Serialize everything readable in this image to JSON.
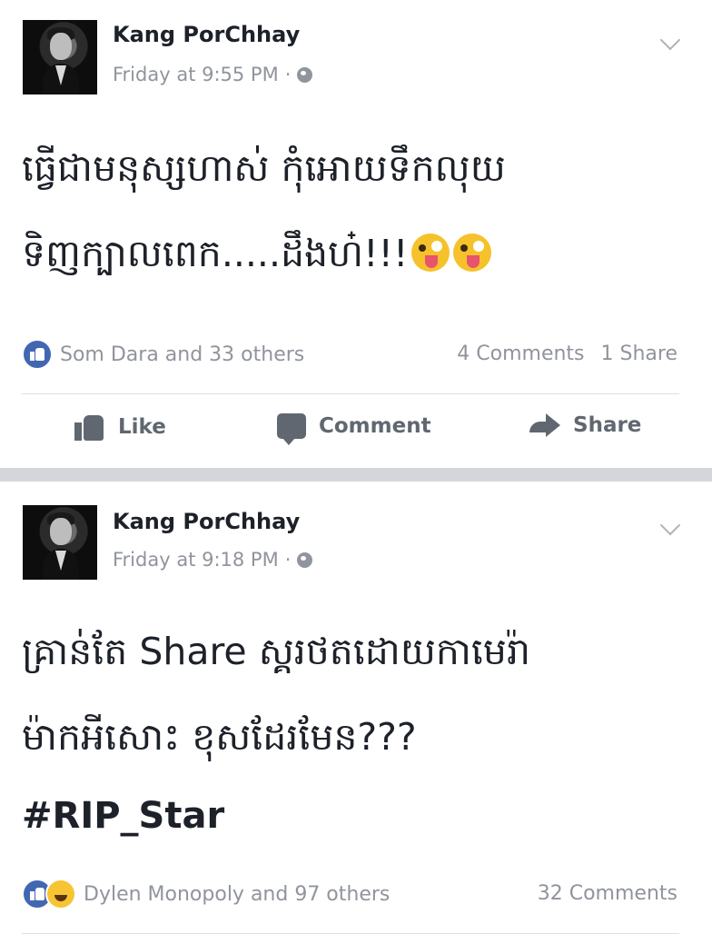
{
  "posts": [
    {
      "author": "Kang PorChhay",
      "timestamp": "Friday at 9:55 PM",
      "separator": "·",
      "privacy_icon": "globe-icon",
      "text_line_1": "ធ្វើជាមនុស្សហាស់ កុំអោយទឹកលុយ",
      "text_line_2": "ទិញក្បាលពេក.....ដឹងហ៎!!!",
      "emojis": [
        "winking-tongue-emoji",
        "winking-tongue-emoji"
      ],
      "reactions_text": "Som Dara and 33 others",
      "comments": "4 Comments",
      "shares": "1 Share",
      "actions": {
        "like": "Like",
        "comment": "Comment",
        "share": "Share"
      }
    },
    {
      "author": "Kang PorChhay",
      "timestamp": "Friday at 9:18 PM",
      "separator": "·",
      "privacy_icon": "globe-icon",
      "text_line_1": "គ្រាន់តែ Share ស្គរថតដោយកាមេរ៉ា",
      "text_line_2": "ម៉ាកអីសោះ ខុសដែរមែន???",
      "hashtag": "#RIP_Star",
      "reactions_text": "Dylen Monopoly and 97 others",
      "comments": "32 Comments"
    }
  ],
  "colors": {
    "accent": "#4267b2",
    "meta_text": "#90949c",
    "separator": "#d5d6d9"
  }
}
